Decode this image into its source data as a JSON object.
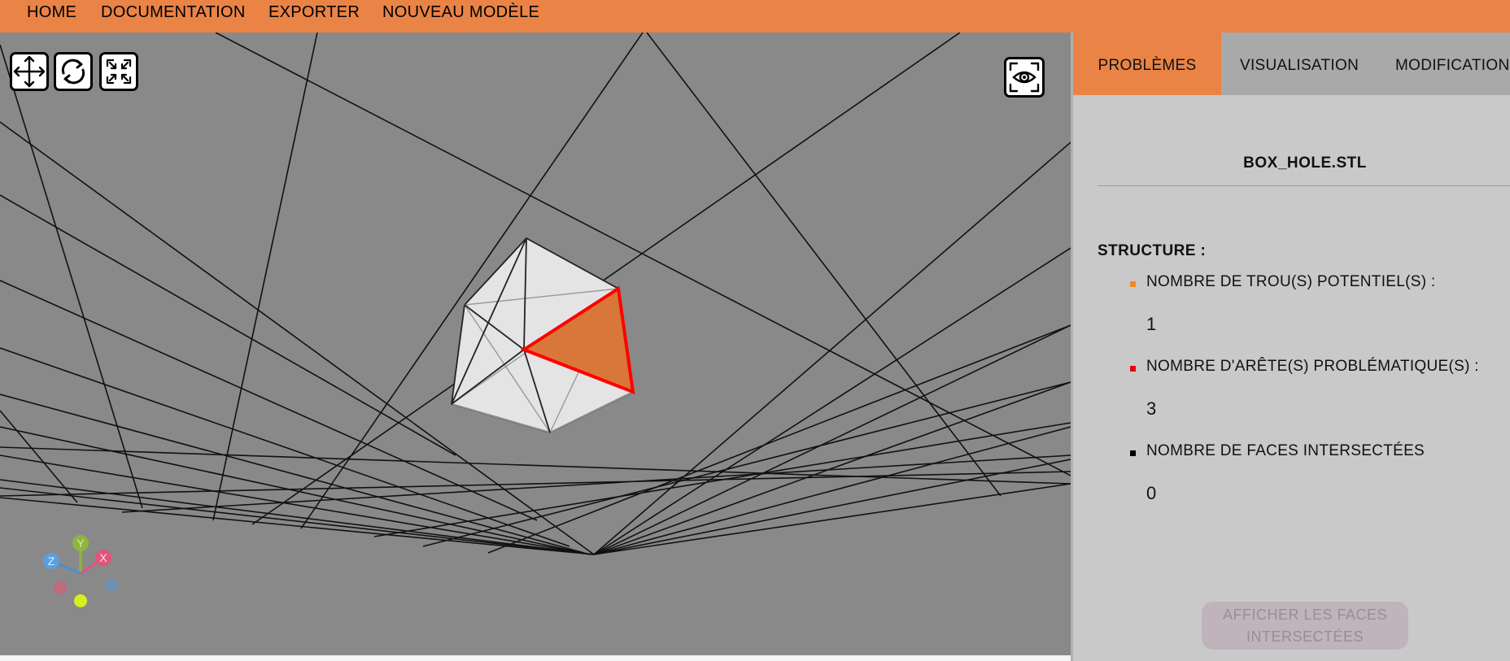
{
  "nav": {
    "items": [
      {
        "label": "HOME"
      },
      {
        "label": "DOCUMENTATION"
      },
      {
        "label": "EXPORTER"
      },
      {
        "label": "NOUVEAU MODÈLE"
      }
    ]
  },
  "viewport": {
    "tools": [
      {
        "icon": "move-arrows-icon"
      },
      {
        "icon": "rotate-icon"
      },
      {
        "icon": "fullscreen-icon"
      }
    ],
    "view_icon": "eye-icon",
    "axis_labels": {
      "x": "X",
      "y": "Y",
      "z": "Z"
    },
    "colors": {
      "background": "#898989",
      "grid": "#111111",
      "mesh_fill": "#e2e2e2",
      "problem_edge": "#ff0000",
      "problem_face": "#d9773a"
    }
  },
  "panel": {
    "tabs": [
      {
        "label": "PROBLÈMES",
        "active": true
      },
      {
        "label": "VISUALISATION",
        "active": false
      },
      {
        "label": "MODIFICATION",
        "active": false
      }
    ],
    "file_name": "BOX_HOLE.STL",
    "section_title": "STRUCTURE :",
    "rows": [
      {
        "label": "NOMBRE DE TROU(S) POTENTIEL(S) :",
        "value": "1",
        "color": "#f08a24"
      },
      {
        "label": "NOMBRE D'ARÊTE(S) PROBLÉMATIQUE(S) :",
        "value": "3",
        "color": "#ee0000"
      },
      {
        "label": "NOMBRE DE FACES INTERSECTÉES",
        "value": "0",
        "color": "#000000"
      }
    ],
    "action_button": "AFFICHER LES FACES INTERSECTÉES",
    "accent_color": "#e98346"
  }
}
